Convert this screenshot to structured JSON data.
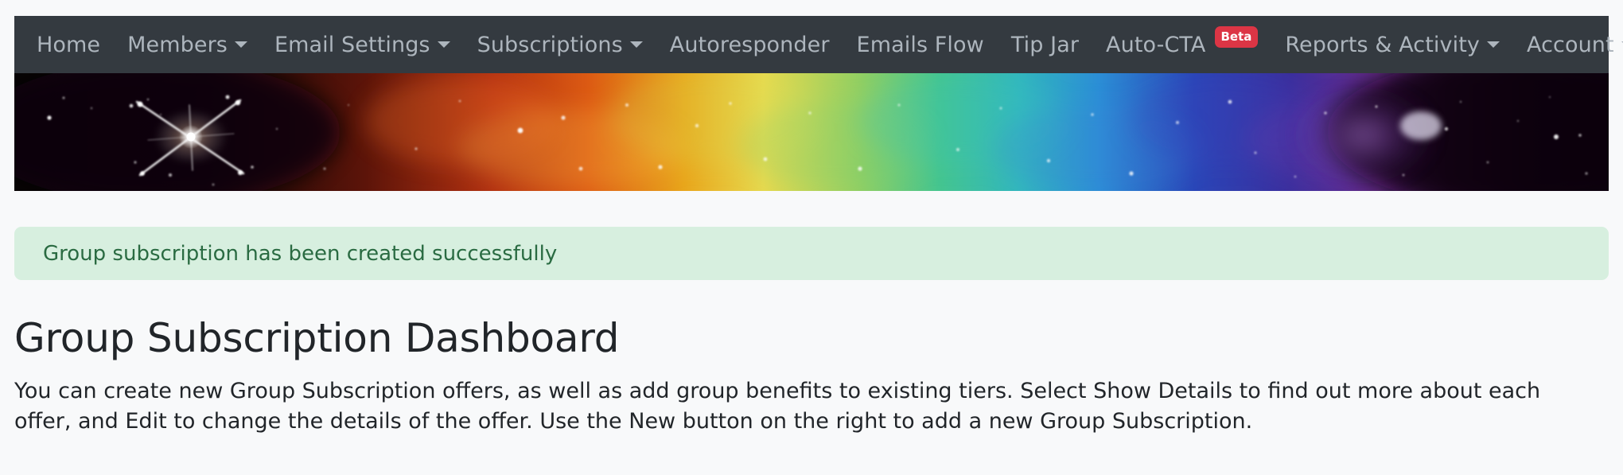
{
  "navbar": {
    "background_color": "#343a40",
    "link_color": "#adb5bd",
    "items": [
      {
        "label": "Home",
        "has_caret": false,
        "badge": null
      },
      {
        "label": "Members",
        "has_caret": true,
        "badge": null
      },
      {
        "label": "Email Settings",
        "has_caret": true,
        "badge": null
      },
      {
        "label": "Subscriptions",
        "has_caret": true,
        "badge": null
      },
      {
        "label": "Autoresponder",
        "has_caret": false,
        "badge": null
      },
      {
        "label": "Emails Flow",
        "has_caret": false,
        "badge": null
      },
      {
        "label": "Tip Jar",
        "has_caret": false,
        "badge": null
      },
      {
        "label": "Auto-CTA",
        "has_caret": false,
        "badge": "Beta"
      },
      {
        "label": "Reports & Activity",
        "has_caret": true,
        "badge": null
      },
      {
        "label": "Account",
        "has_caret": true,
        "badge": null
      }
    ],
    "badge_color": "#dc3545"
  },
  "banner": {
    "description": "Rainbow nebula starfield banner image",
    "colors": [
      "#0a0406",
      "#8c1f10",
      "#d9480f",
      "#e8a317",
      "#e6d34a",
      "#7dc96a",
      "#3fbfa8",
      "#2a8ad4",
      "#2c39a8",
      "#6b2fa0",
      "#0b0610"
    ]
  },
  "alert": {
    "message": "Group subscription has been created successfully",
    "background_color": "#d7efdf",
    "text_color": "#2a6b42"
  },
  "main": {
    "title": "Group Subscription Dashboard",
    "description": "You can create new Group Subscription offers, as well as add group benefits to existing tiers. Select Show Details to find out more about each offer, and Edit to change the details of the offer. Use the New button on the right to add a new Group Subscription."
  }
}
